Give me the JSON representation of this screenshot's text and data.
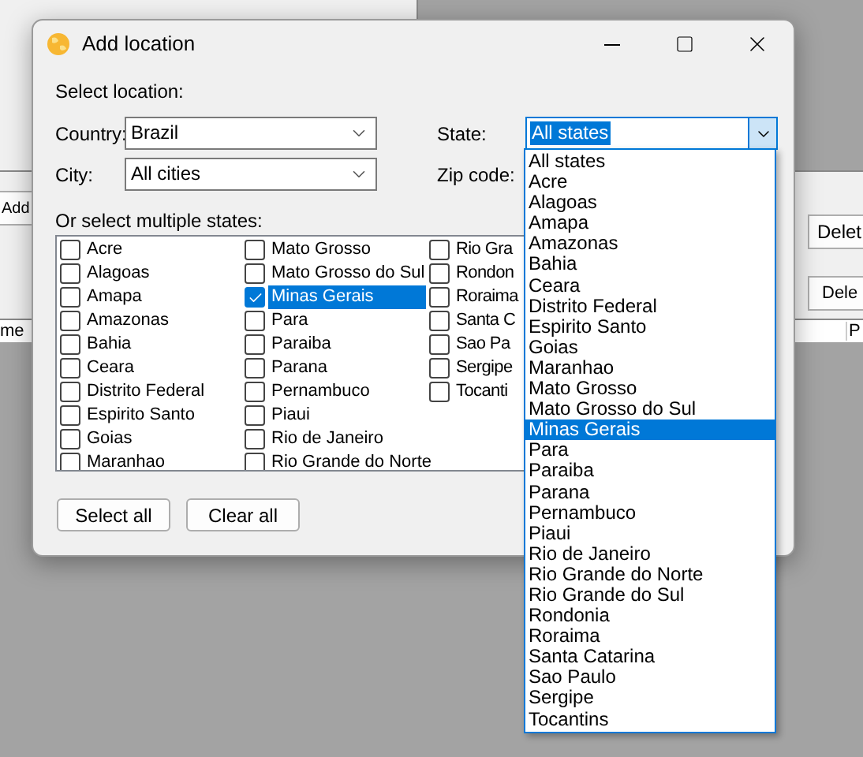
{
  "background_window": {
    "texts": [
      "Add",
      "Delet",
      "Dele",
      "me",
      "P"
    ]
  },
  "dialog": {
    "title": "Add location",
    "section_label": "Select location:",
    "country": {
      "label": "Country:",
      "value": "Brazil"
    },
    "city": {
      "label": "City:",
      "value": "All cities"
    },
    "state": {
      "label": "State:",
      "value": "All states",
      "expanded": true
    },
    "zip": {
      "label": "Zip code:"
    },
    "multi_label": "Or select multiple states:",
    "states_list": [
      {
        "label": "Acre",
        "checked": false,
        "selected": false
      },
      {
        "label": "Alagoas",
        "checked": false,
        "selected": false
      },
      {
        "label": "Amapa",
        "checked": false,
        "selected": false
      },
      {
        "label": "Amazonas",
        "checked": false,
        "selected": false
      },
      {
        "label": "Bahia",
        "checked": false,
        "selected": false
      },
      {
        "label": "Ceara",
        "checked": false,
        "selected": false
      },
      {
        "label": "Distrito Federal",
        "checked": false,
        "selected": false
      },
      {
        "label": "Espirito Santo",
        "checked": false,
        "selected": false
      },
      {
        "label": "Goias",
        "checked": false,
        "selected": false
      },
      {
        "label": "Maranhao",
        "checked": false,
        "selected": false
      },
      {
        "label": "Mato Grosso",
        "checked": false,
        "selected": false
      },
      {
        "label": "Mato Grosso do Sul",
        "checked": false,
        "selected": false
      },
      {
        "label": "Minas Gerais",
        "checked": true,
        "selected": true
      },
      {
        "label": "Para",
        "checked": false,
        "selected": false
      },
      {
        "label": "Paraiba",
        "checked": false,
        "selected": false
      },
      {
        "label": "Parana",
        "checked": false,
        "selected": false
      },
      {
        "label": "Pernambuco",
        "checked": false,
        "selected": false
      },
      {
        "label": "Piaui",
        "checked": false,
        "selected": false
      },
      {
        "label": "Rio de Janeiro",
        "checked": false,
        "selected": false
      },
      {
        "label": "Rio Grande do Norte",
        "checked": false,
        "selected": false
      },
      {
        "label": "Rio Gra",
        "checked": false,
        "selected": false
      },
      {
        "label": "Rondon",
        "checked": false,
        "selected": false
      },
      {
        "label": "Roraima",
        "checked": false,
        "selected": false
      },
      {
        "label": "Santa C",
        "checked": false,
        "selected": false
      },
      {
        "label": "Sao Pa",
        "checked": false,
        "selected": false
      },
      {
        "label": "Sergipe",
        "checked": false,
        "selected": false
      },
      {
        "label": "Tocanti",
        "checked": false,
        "selected": false
      }
    ],
    "buttons": [
      "Select all",
      "Clear all"
    ],
    "state_dropdown": [
      {
        "label": "All states",
        "selected": false
      },
      {
        "label": "Acre",
        "selected": false
      },
      {
        "label": "Alagoas",
        "selected": false
      },
      {
        "label": "Amapa",
        "selected": false
      },
      {
        "label": "Amazonas",
        "selected": false
      },
      {
        "label": "Bahia",
        "selected": false
      },
      {
        "label": "Ceara",
        "selected": false
      },
      {
        "label": "Distrito Federal",
        "selected": false
      },
      {
        "label": "Espirito Santo",
        "selected": false
      },
      {
        "label": "Goias",
        "selected": false
      },
      {
        "label": "Maranhao",
        "selected": false
      },
      {
        "label": "Mato Grosso",
        "selected": false
      },
      {
        "label": "Mato Grosso do Sul",
        "selected": false
      },
      {
        "label": "Minas Gerais",
        "selected": true
      },
      {
        "label": "Para",
        "selected": false
      },
      {
        "label": "Paraiba",
        "selected": false
      },
      {
        "label": "Parana",
        "selected": false
      },
      {
        "label": "Pernambuco",
        "selected": false
      },
      {
        "label": "Piaui",
        "selected": false
      },
      {
        "label": "Rio de Janeiro",
        "selected": false
      },
      {
        "label": "Rio Grande do Norte",
        "selected": false
      },
      {
        "label": "Rio Grande do Sul",
        "selected": false
      },
      {
        "label": "Rondonia",
        "selected": false
      },
      {
        "label": "Roraima",
        "selected": false
      },
      {
        "label": "Santa Catarina",
        "selected": false
      },
      {
        "label": "Sao Paulo",
        "selected": false
      },
      {
        "label": "Sergipe",
        "selected": false
      },
      {
        "label": "Tocantins",
        "selected": false
      }
    ]
  }
}
